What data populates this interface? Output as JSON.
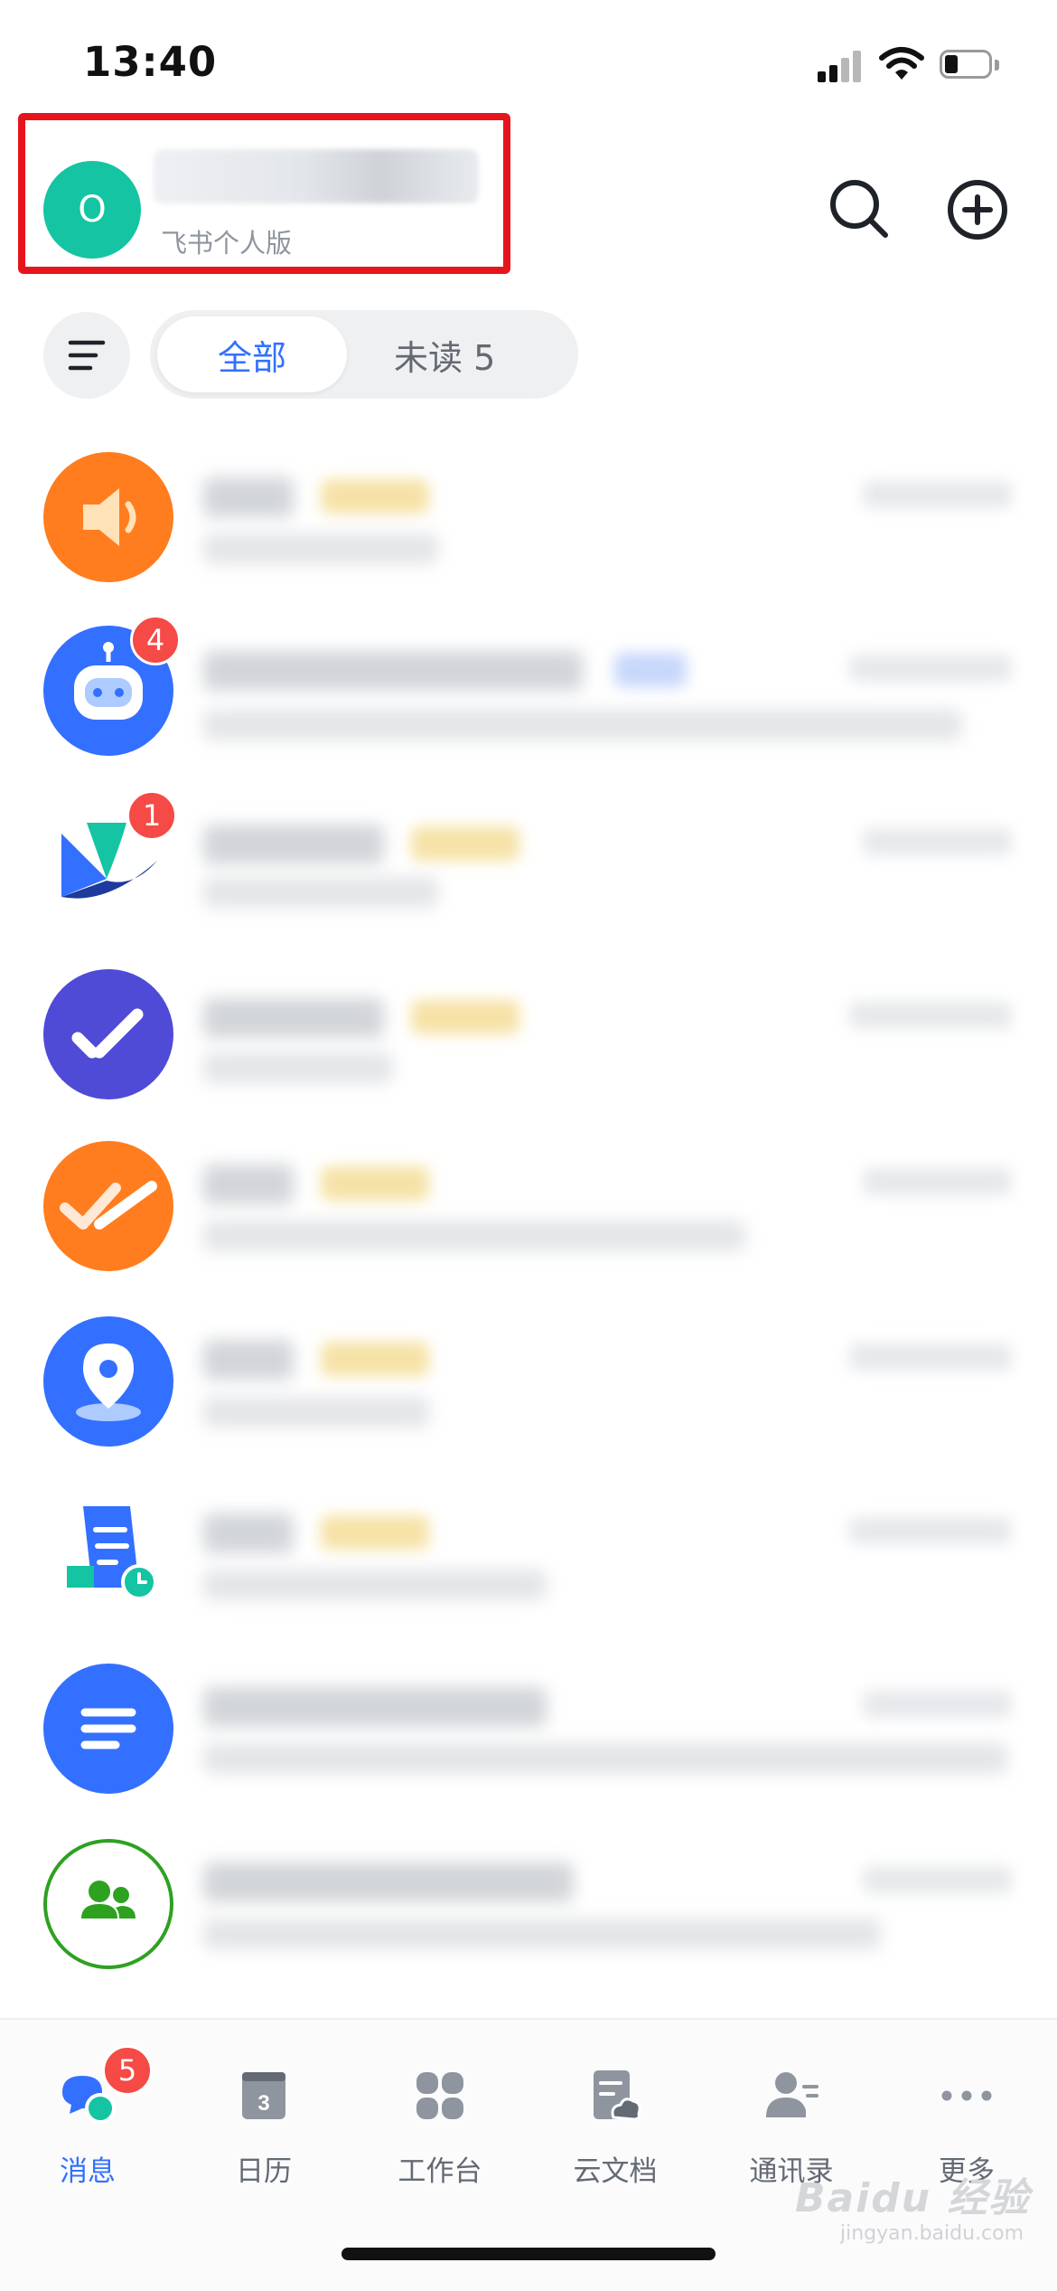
{
  "status_bar": {
    "time": "13:40"
  },
  "header": {
    "avatar_initial": "O",
    "account_name": "",
    "account_subtitle": "飞书个人版",
    "highlight_color": "#e8141c",
    "search_icon": "search-icon",
    "add_icon": "plus-circle-icon"
  },
  "filters": {
    "menu_icon": "list-filter-icon",
    "tabs": [
      {
        "label": "全部",
        "selected": true
      },
      {
        "label": "未读 5",
        "selected": false
      }
    ]
  },
  "chats": [
    {
      "icon": "speaker-icon",
      "icon_color": "#ff7d1f",
      "badge": null
    },
    {
      "icon": "robot-icon",
      "icon_color": "#3370ff",
      "badge": "4"
    },
    {
      "icon": "bird-logo-icon",
      "icon_color": "#1e3a9c",
      "badge": "1"
    },
    {
      "icon": "task-check-icon",
      "icon_color": "#4f4bd6",
      "badge": null
    },
    {
      "icon": "approval-check-icon",
      "icon_color": "#ff7d1f",
      "badge": null
    },
    {
      "icon": "location-pin-icon",
      "icon_color": "#3370ff",
      "badge": null
    },
    {
      "icon": "document-clock-icon",
      "icon_color": "#3370ff",
      "badge": null
    },
    {
      "icon": "text-lines-icon",
      "icon_color": "#3370ff",
      "badge": null
    },
    {
      "icon": "group-users-icon",
      "icon_color": "#2ea121",
      "badge": null
    }
  ],
  "tab_bar": {
    "items": [
      {
        "label": "消息",
        "icon": "chat-bubbles-icon",
        "active": true,
        "badge": "5"
      },
      {
        "label": "日历",
        "icon": "calendar-icon",
        "active": false,
        "calendar_day": "3"
      },
      {
        "label": "工作台",
        "icon": "apps-grid-icon",
        "active": false
      },
      {
        "label": "云文档",
        "icon": "cloud-doc-icon",
        "active": false
      },
      {
        "label": "通讯录",
        "icon": "contacts-icon",
        "active": false
      },
      {
        "label": "更多",
        "icon": "more-dots-icon",
        "active": false
      }
    ]
  },
  "watermark": {
    "brand": "Baidu 经验",
    "url": "jingyan.baidu.com"
  },
  "colors": {
    "accent": "#3370ff",
    "badge": "#f54a45",
    "avatar": "#14c4a2"
  }
}
